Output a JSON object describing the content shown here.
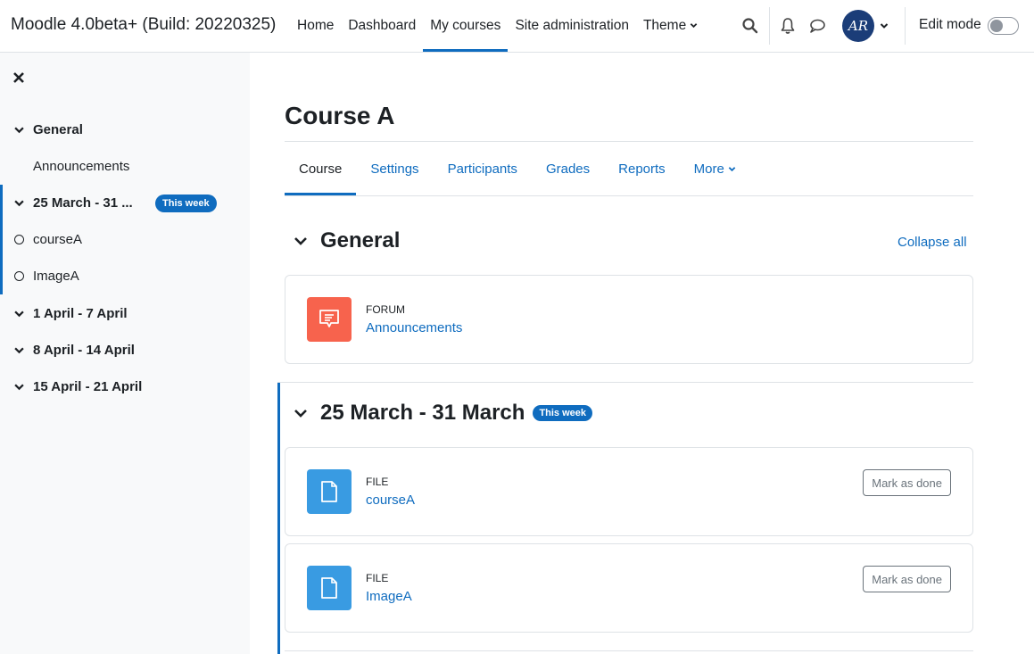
{
  "navbar": {
    "brand": "Moodle 4.0beta+ (Build: 20220325)",
    "links": [
      "Home",
      "Dashboard",
      "My courses",
      "Site administration",
      "Theme"
    ],
    "active": "My courses",
    "avatar_initials": "AR",
    "edit_mode_label": "Edit mode",
    "edit_mode_on": false
  },
  "drawer": {
    "items": [
      {
        "label": "General",
        "type": "section"
      },
      {
        "label": "Announcements",
        "type": "activity"
      },
      {
        "label": "25 March - 31 ...",
        "type": "section",
        "badge": "This week"
      },
      {
        "label": "courseA",
        "type": "activity-circle"
      },
      {
        "label": "ImageA",
        "type": "activity-circle"
      },
      {
        "label": "1 April - 7 April",
        "type": "section"
      },
      {
        "label": "8 April - 14 April",
        "type": "section"
      },
      {
        "label": "15 April - 21 April",
        "type": "section"
      }
    ]
  },
  "main": {
    "course_title": "Course A",
    "tabs": [
      "Course",
      "Settings",
      "Participants",
      "Grades",
      "Reports",
      "More"
    ],
    "active_tab": "Course",
    "collapse_all": "Collapse all",
    "sections": [
      {
        "name": "General",
        "activities": [
          {
            "type": "FORUM",
            "name": "Announcements",
            "icon": "forum-icon"
          }
        ]
      },
      {
        "name": "25 March - 31 March",
        "badge": "This week",
        "activities": [
          {
            "type": "FILE",
            "name": "courseA",
            "icon": "file-icon",
            "button": "Mark as done"
          },
          {
            "type": "FILE",
            "name": "ImageA",
            "icon": "file-icon",
            "button": "Mark as done"
          }
        ]
      }
    ]
  },
  "colors": {
    "primary": "#0f6cbf",
    "forum": "#f7634d",
    "file": "#399be2",
    "drawer_bg": "#f8f9fa"
  }
}
